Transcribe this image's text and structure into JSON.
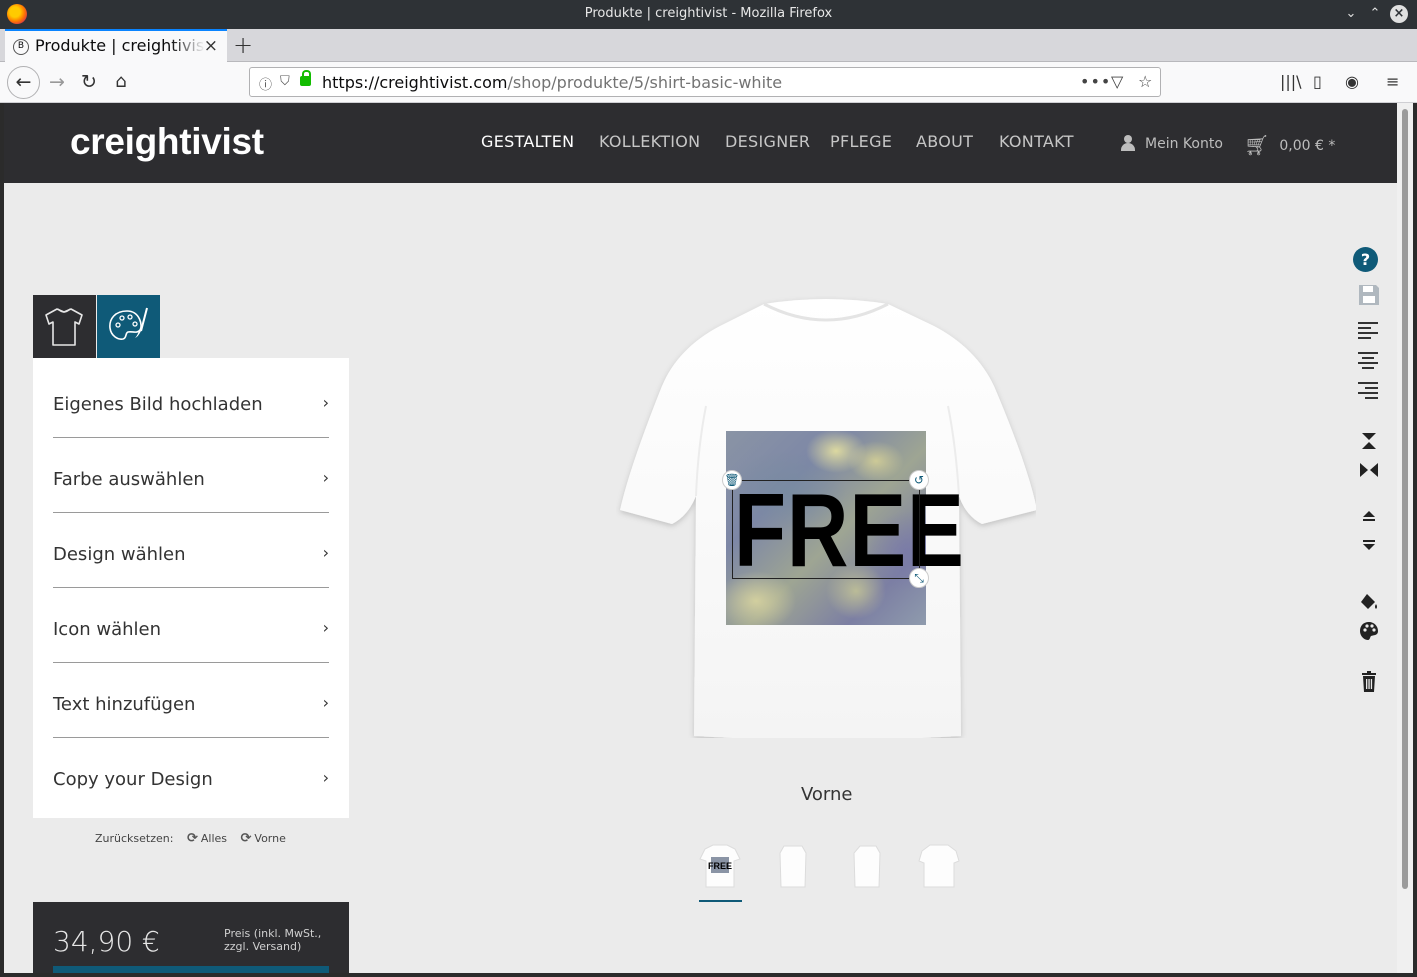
{
  "window": {
    "title": "Produkte | creightivist - Mozilla Firefox"
  },
  "browser": {
    "tab_title": "Produkte | creightivist",
    "url_domain": "https://creightivist.com",
    "url_path": "/shop/produkte/5/shirt-basic-white"
  },
  "site": {
    "logo": "creightivist",
    "nav": [
      "GESTALTEN",
      "KOLLEKTION",
      "DESIGNER",
      "PFLEGE",
      "ABOUT",
      "KONTAKT"
    ],
    "account_label": "Mein Konto",
    "cart_total": "0,00 € *"
  },
  "designer": {
    "menu": [
      "Eigenes Bild hochladen",
      "Farbe auswählen",
      "Design wählen",
      "Icon wählen",
      "Text hinzufügen",
      "Copy your Design"
    ],
    "reset_label": "Zurücksetzen:",
    "reset_all": "Alles",
    "reset_front": "Vorne",
    "design_text": "FREE",
    "view_label": "Vorne",
    "price": "34,90 €",
    "price_note": "Preis (inkl. MwSt., zzgl. Versand)",
    "help_label": "?"
  },
  "colors": {
    "accent": "#0f5a78",
    "header_bg": "#2d2d30",
    "page_bg": "#ebebeb"
  }
}
